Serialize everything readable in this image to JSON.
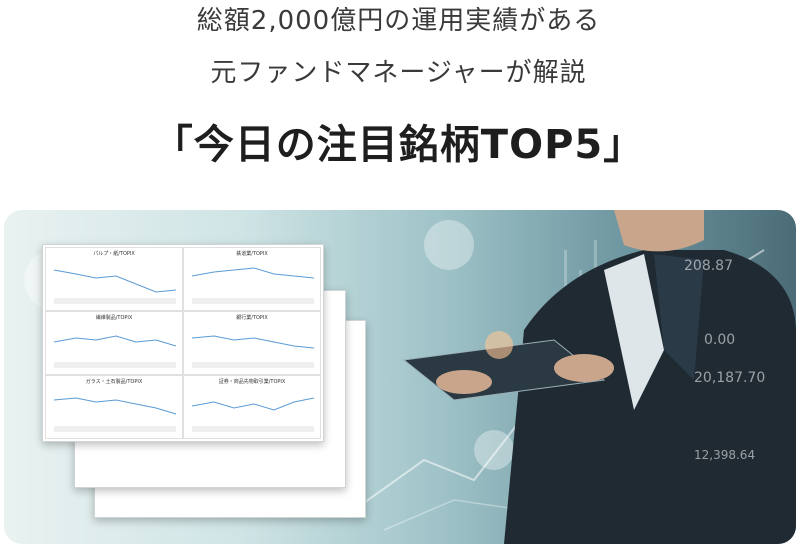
{
  "header": {
    "line1": "総額2,000億円の運用実績がある",
    "line2": "元ファンドマネージャーが解説",
    "title": "「今日の注目銘柄TOP5」"
  },
  "hero": {
    "panel_titles": [
      "パルプ・紙/TOPIX",
      "鉄道業/TOPIX",
      "繊維製品/TOPIX",
      "銀行業/TOPIX",
      "ガラス・土石製品/TOPIX",
      "証券・商品先物取引業/TOPIX"
    ],
    "screen_numbers": [
      "208.87",
      "0.00",
      "20,187.70",
      "12,398.64"
    ]
  },
  "colors": {
    "title": "#1e1e1e",
    "subtitle": "#3a3a3a",
    "chart_line": "#5b9bd5"
  }
}
